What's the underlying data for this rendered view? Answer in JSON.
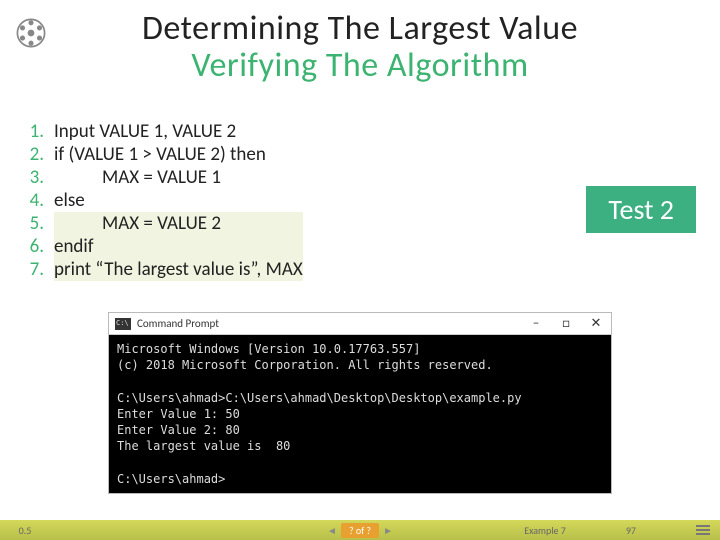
{
  "title": {
    "line1": "Determining The Largest Value",
    "line2": "Verifying The Algorithm"
  },
  "steps": [
    {
      "n": "1.",
      "text": "Input VALUE 1, VALUE 2",
      "indent": 1,
      "hl": false
    },
    {
      "n": "2.",
      "text": "if (VALUE 1 > VALUE 2) then",
      "indent": 1,
      "hl": false
    },
    {
      "n": "3.",
      "text": "MAX = VALUE 1",
      "indent": 2,
      "hl": false
    },
    {
      "n": "4.",
      "text": "else",
      "indent": 1,
      "hl": false
    },
    {
      "n": "5.",
      "text": "MAX = VALUE 2",
      "indent": 2,
      "hl": true
    },
    {
      "n": "6.",
      "text": "endif",
      "indent": 1,
      "hl": true
    },
    {
      "n": "7.",
      "text": "print “The largest value is”, MAX",
      "indent": 1,
      "hl": true
    }
  ],
  "badge": "Test 2",
  "terminal": {
    "title": "Command Prompt",
    "controls": {
      "min": "–",
      "max": "□",
      "close": "✕"
    },
    "lines": "Microsoft Windows [Version 10.0.17763.557]\n(c) 2018 Microsoft Corporation. All rights reserved.\n\nC:\\Users\\ahmad>C:\\Users\\ahmad\\Desktop\\Desktop\\example.py\nEnter Value 1: 50\nEnter Value 2: 80\nThe largest value is  80\n\nC:\\Users\\ahmad>"
  },
  "footer": {
    "left": "0.5",
    "center": "? of ?",
    "prev": "◄",
    "next": "►",
    "example": "Example 7",
    "page": "97"
  }
}
